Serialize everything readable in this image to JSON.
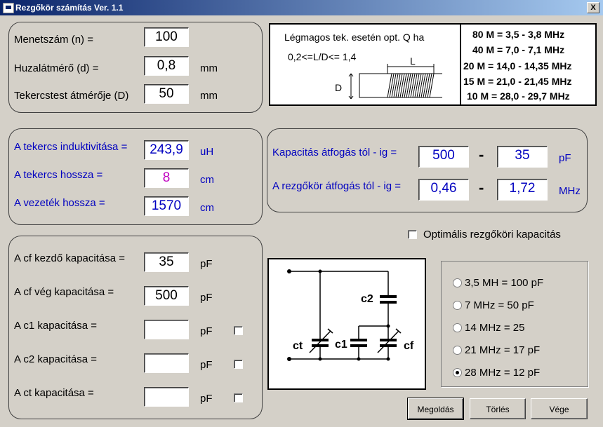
{
  "window": {
    "title": "Rezgőkör számítás Ver. 1.1",
    "close_label": "X"
  },
  "inputs_panel": {
    "turns_label": "Menetszám  (n)  =",
    "turns_value": "100",
    "wire_label": "Huzalátmérő  (d) =",
    "wire_value": "0,8",
    "wire_unit": "mm",
    "body_label": "Tekercstest átmérője (D)",
    "body_value": "50",
    "body_unit": "mm"
  },
  "info": {
    "line1": "Légmagos tek. esetén opt. Q ha",
    "line2": "0,2<=L/D<= 1,4",
    "L": "L",
    "D": "D",
    "bands": [
      "80 M = 3,5 - 3,8 MHz",
      "40 M = 7,0 - 7,1 MHz",
      "20 M = 14,0 - 14,35 MHz",
      "15 M = 21,0 - 21,45 MHz",
      "10 M = 28,0 - 29,7 MHz"
    ]
  },
  "results_panel": {
    "inductance_label": "A tekercs induktivitása  =",
    "inductance_value": "243,9",
    "inductance_unit": "uH",
    "length_label": "A tekercs hossza =",
    "length_value": "8",
    "length_unit": "cm",
    "wirelen_label": "A vezeték hossza =",
    "wirelen_value": "1570",
    "wirelen_unit": "cm"
  },
  "range_panel": {
    "cap_label": "Kapacitás átfogás  tól - ig  =",
    "cap_from": "500",
    "cap_to": "35",
    "cap_unit": "pF",
    "freq_label": "A rezgőkör átfogás tól - ig  =",
    "freq_from": "0,46",
    "freq_to": "1,72",
    "freq_unit": "MHz",
    "dash": "-"
  },
  "optimal": {
    "label": "Optimális rezgőköri kapacitás",
    "checked": false
  },
  "caps_panel": {
    "cf_start_label": "A cf kezdő kapacitása =",
    "cf_start_value": "35",
    "cf_end_label": "A cf vég kapacitása =",
    "cf_end_value": "500",
    "c1_label": "A c1 kapacitása =",
    "c1_value": "",
    "c2_label": "A c2 kapacitása =",
    "c2_value": "",
    "ct_label": "A ct kapacitása =",
    "ct_value": "",
    "unit": "pF"
  },
  "circuit": {
    "ct": "ct",
    "c1": "c1",
    "c2": "c2",
    "cf": "cf"
  },
  "presets": {
    "options": [
      "3,5 MH  = 100 pF",
      "7 MHz = 50 pF",
      "14 MHz = 25",
      "21 MHz = 17 pF",
      "28 MHz = 12 pF"
    ],
    "selected_index": 4
  },
  "buttons": {
    "solve": "Megoldás",
    "clear": "Törlés",
    "end": "Vége"
  }
}
